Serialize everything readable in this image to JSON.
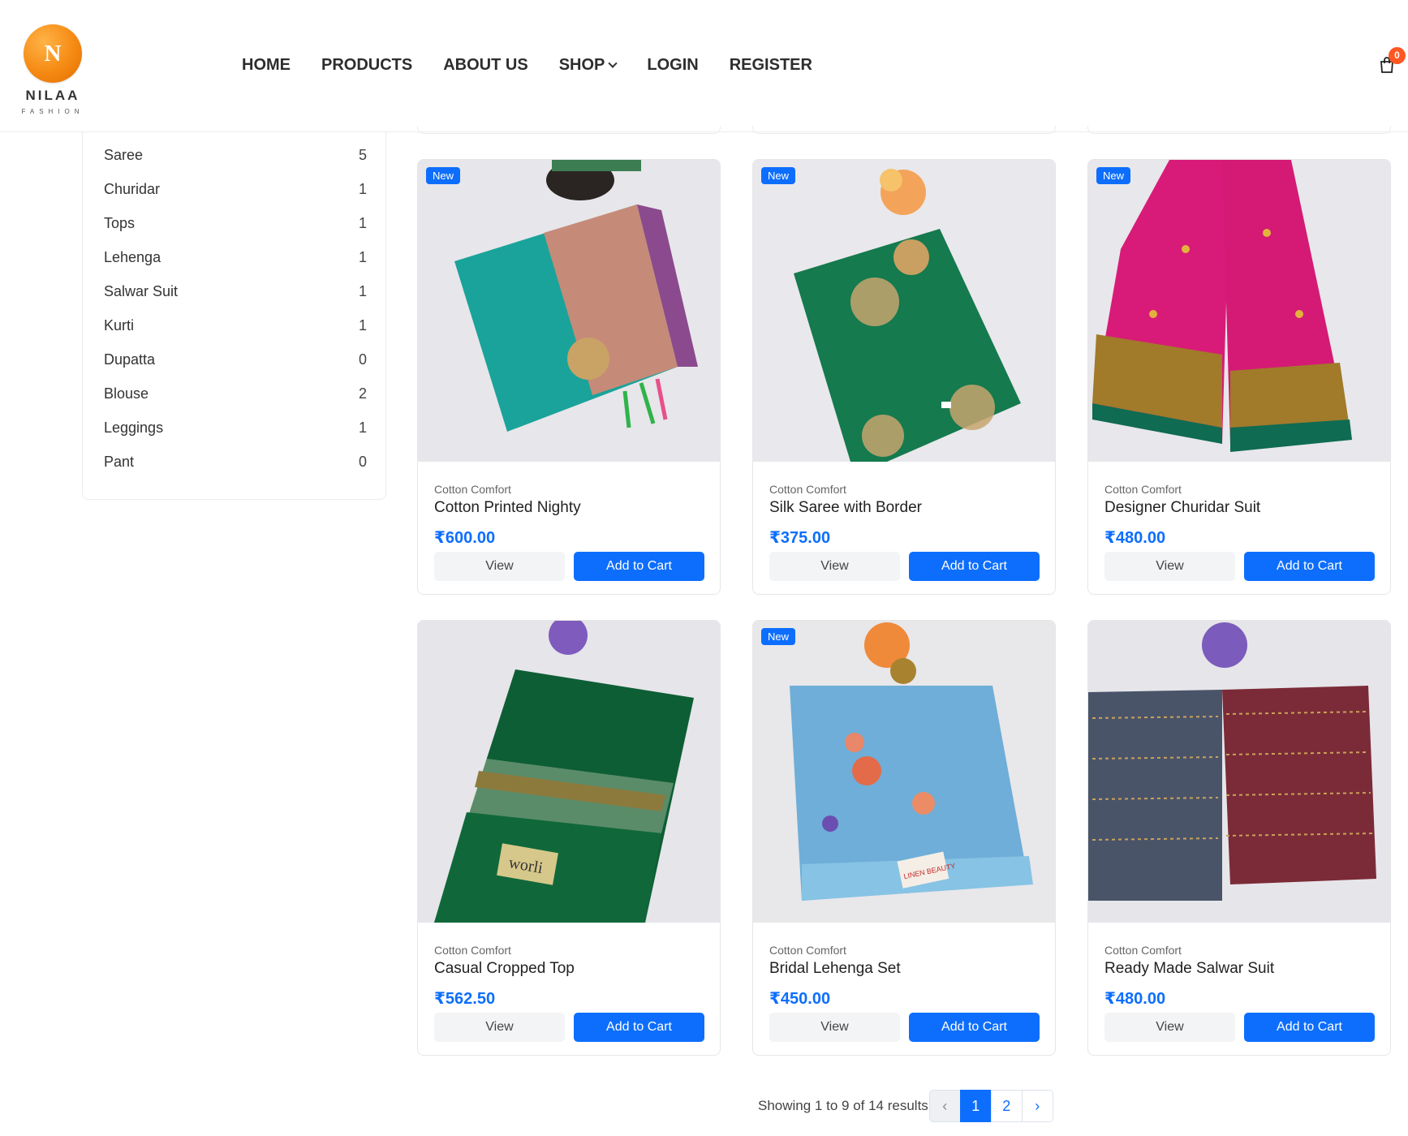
{
  "header": {
    "logo_letter": "N",
    "logo_name": "NILAA",
    "logo_sub": "FASHION",
    "nav": [
      "HOME",
      "PRODUCTS",
      "ABOUT US",
      "SHOP",
      "LOGIN",
      "REGISTER"
    ],
    "cart_count": "0",
    "cart_icon": "shopping-bag-icon"
  },
  "categories": [
    {
      "name": "Saree",
      "count": "5"
    },
    {
      "name": "Churidar",
      "count": "1"
    },
    {
      "name": "Tops",
      "count": "1"
    },
    {
      "name": "Lehenga",
      "count": "1"
    },
    {
      "name": "Salwar Suit",
      "count": "1"
    },
    {
      "name": "Kurti",
      "count": "1"
    },
    {
      "name": "Dupatta",
      "count": "0"
    },
    {
      "name": "Blouse",
      "count": "2"
    },
    {
      "name": "Leggings",
      "count": "1"
    },
    {
      "name": "Pant",
      "count": "0"
    }
  ],
  "products": [
    {
      "brand": "Cotton Comfort",
      "title": "Cotton Printed Nighty",
      "price": "₹600.00",
      "badge": "New",
      "view": "View",
      "add": "Add to Cart"
    },
    {
      "brand": "Cotton Comfort",
      "title": "Silk Saree with Border",
      "price": "₹375.00",
      "badge": "New",
      "view": "View",
      "add": "Add to Cart"
    },
    {
      "brand": "Cotton Comfort",
      "title": "Designer Churidar Suit",
      "price": "₹480.00",
      "badge": "New",
      "view": "View",
      "add": "Add to Cart"
    },
    {
      "brand": "Cotton Comfort",
      "title": "Casual Cropped Top",
      "price": "₹562.50",
      "badge": "",
      "view": "View",
      "add": "Add to Cart"
    },
    {
      "brand": "Cotton Comfort",
      "title": "Bridal Lehenga Set",
      "price": "₹450.00",
      "badge": "New",
      "view": "View",
      "add": "Add to Cart"
    },
    {
      "brand": "Cotton Comfort",
      "title": "Ready Made Salwar Suit",
      "price": "₹480.00",
      "badge": "",
      "view": "View",
      "add": "Add to Cart"
    }
  ],
  "pagination": {
    "info": "Showing 1 to 9 of 14 results",
    "prev": "‹",
    "pages": [
      "1",
      "2"
    ],
    "next": "›",
    "current": "1"
  },
  "colors": {
    "accent": "#0d6efd",
    "logo": "#f58a13",
    "badge": "#ff5722"
  }
}
